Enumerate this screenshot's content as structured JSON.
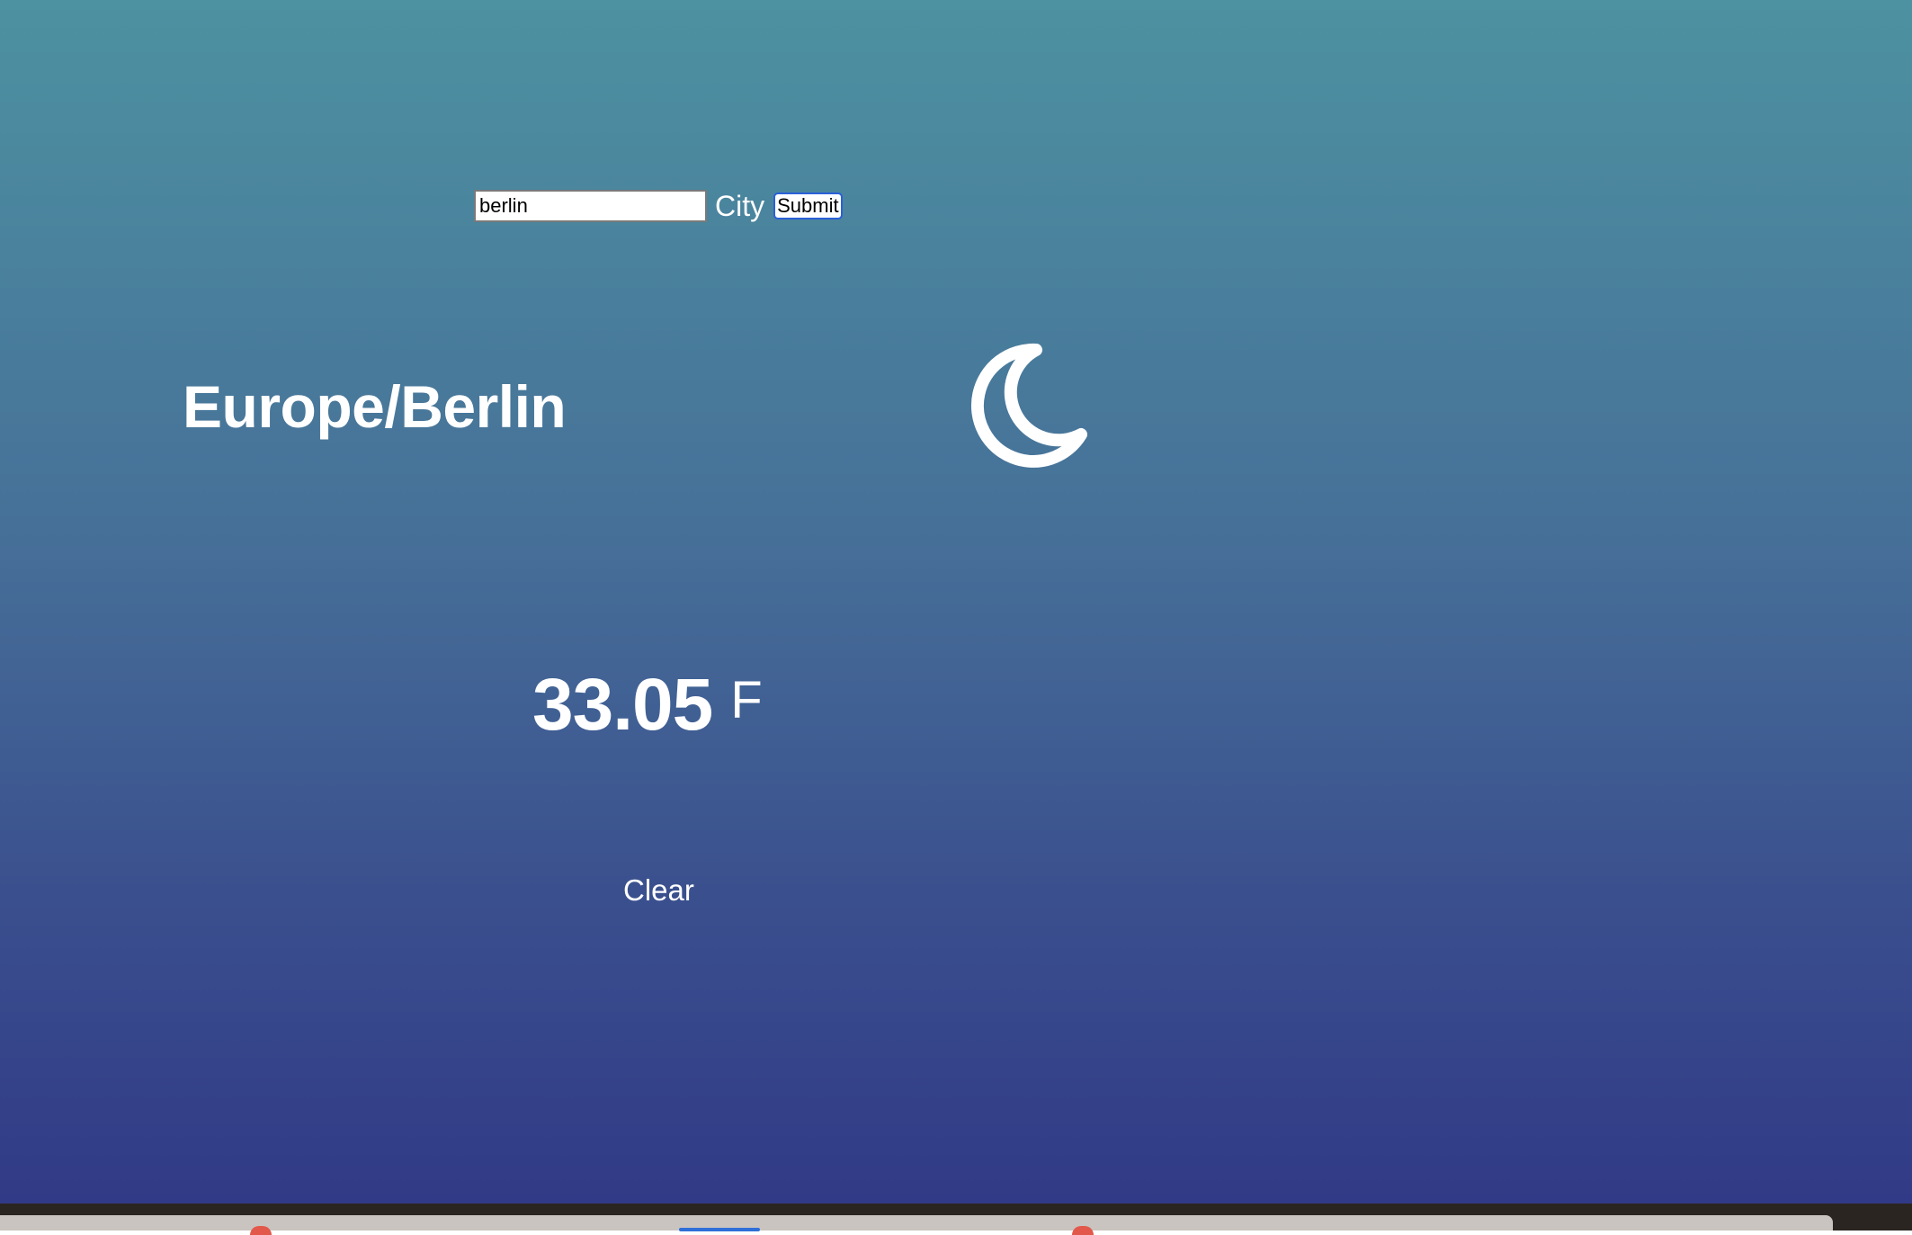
{
  "search": {
    "value": "berlin",
    "label": "City",
    "submit_label": "Submit"
  },
  "weather": {
    "timezone": "Europe/Berlin",
    "icon": "crescent-moon-icon",
    "temperature": "33.05",
    "unit": "F",
    "description": "Clear"
  },
  "colors": {
    "gradient_top": "#4d92a1",
    "gradient_bottom": "#313a86",
    "text": "#ffffff"
  }
}
